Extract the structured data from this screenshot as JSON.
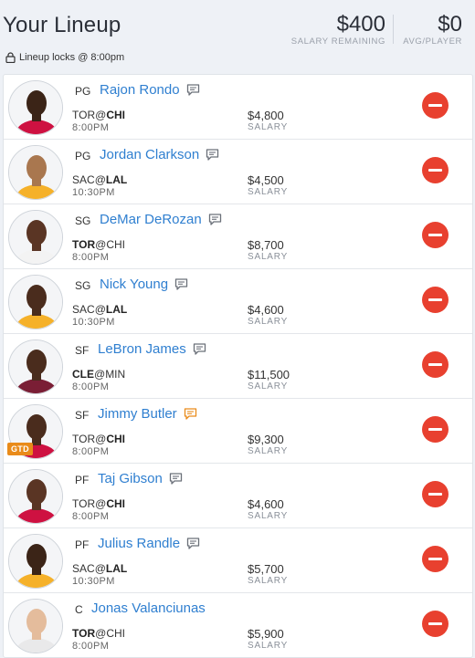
{
  "header": {
    "title": "Your Lineup",
    "locks_text": "Lineup locks @ 8:00pm",
    "salary_remaining_value": "$400",
    "salary_remaining_label": "SALARY REMAINING",
    "avg_player_value": "$0",
    "avg_player_label": "AVG/PLAYER"
  },
  "colors": {
    "accent_blue": "#2f7fd0",
    "remove_red": "#e8402f",
    "gtd_orange": "#e98b1a"
  },
  "players": [
    {
      "pos": "PG",
      "name": "Rajon Rondo",
      "away": "TOR",
      "home": "CHI",
      "bold": "home",
      "time": "8:00PM",
      "salary": "$4,800",
      "salary_label": "SALARY",
      "jersey": "#ce1141",
      "skin": "#3b2417",
      "note_color": "#6b7079",
      "gtd": ""
    },
    {
      "pos": "PG",
      "name": "Jordan Clarkson",
      "away": "SAC",
      "home": "LAL",
      "bold": "home",
      "time": "10:30PM",
      "salary": "$4,500",
      "salary_label": "SALARY",
      "jersey": "#f5b12a",
      "skin": "#a9774f",
      "note_color": "#6b7079",
      "gtd": ""
    },
    {
      "pos": "SG",
      "name": "DeMar DeRozan",
      "away": "TOR",
      "home": "CHI",
      "bold": "away",
      "time": "8:00PM",
      "salary": "$8,700",
      "salary_label": "SALARY",
      "jersey": "#f3f3f3",
      "skin": "#5a3524",
      "note_color": "#6b7079",
      "gtd": ""
    },
    {
      "pos": "SG",
      "name": "Nick Young",
      "away": "SAC",
      "home": "LAL",
      "bold": "home",
      "time": "10:30PM",
      "salary": "$4,600",
      "salary_label": "SALARY",
      "jersey": "#f5b12a",
      "skin": "#4a2c1d",
      "note_color": "#6b7079",
      "gtd": ""
    },
    {
      "pos": "SF",
      "name": "LeBron James",
      "away": "CLE",
      "home": "MIN",
      "bold": "away",
      "time": "8:00PM",
      "salary": "$11,500",
      "salary_label": "SALARY",
      "jersey": "#7a1e35",
      "skin": "#4a2c1d",
      "note_color": "#6b7079",
      "gtd": ""
    },
    {
      "pos": "SF",
      "name": "Jimmy Butler",
      "away": "TOR",
      "home": "CHI",
      "bold": "home",
      "time": "8:00PM",
      "salary": "$9,300",
      "salary_label": "SALARY",
      "jersey": "#ce1141",
      "skin": "#4a2c1d",
      "note_color": "#e98b1a",
      "gtd": "GTD"
    },
    {
      "pos": "PF",
      "name": "Taj Gibson",
      "away": "TOR",
      "home": "CHI",
      "bold": "home",
      "time": "8:00PM",
      "salary": "$4,600",
      "salary_label": "SALARY",
      "jersey": "#ce1141",
      "skin": "#5a3524",
      "note_color": "#6b7079",
      "gtd": ""
    },
    {
      "pos": "PF",
      "name": "Julius Randle",
      "away": "SAC",
      "home": "LAL",
      "bold": "home",
      "time": "10:30PM",
      "salary": "$5,700",
      "salary_label": "SALARY",
      "jersey": "#f5b12a",
      "skin": "#3b2417",
      "note_color": "#6b7079",
      "gtd": ""
    },
    {
      "pos": "C",
      "name": "Jonas Valanciunas",
      "away": "TOR",
      "home": "CHI",
      "bold": "away",
      "time": "8:00PM",
      "salary": "$5,900",
      "salary_label": "SALARY",
      "jersey": "#e9e9ea",
      "skin": "#e4bc9c",
      "note_color": "",
      "gtd": ""
    }
  ]
}
